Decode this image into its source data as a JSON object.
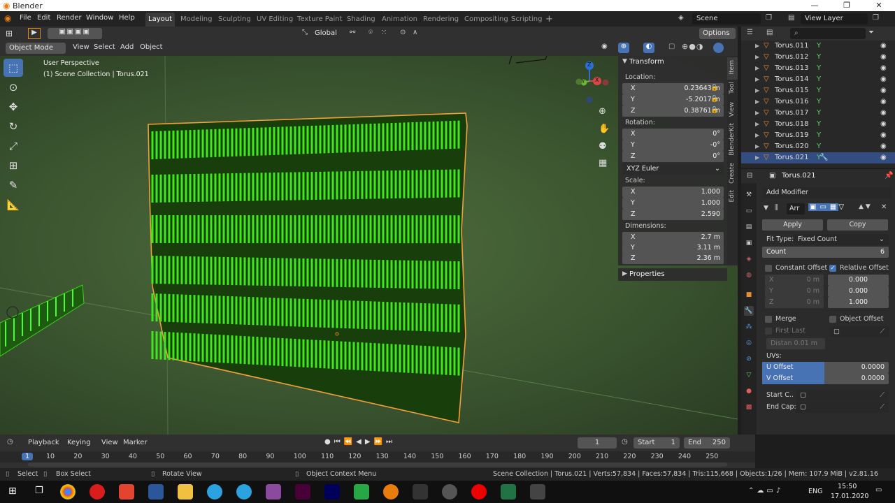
{
  "topbar": {
    "title": "Blender",
    "minimize": "—",
    "maximize": "❐",
    "close": "✕"
  },
  "menu": [
    "File",
    "Edit",
    "Render",
    "Window",
    "Help"
  ],
  "workspaces": [
    "Layout",
    "Modeling",
    "Sculpting",
    "UV Editing",
    "Texture Paint",
    "Shading",
    "Animation",
    "Rendering",
    "Compositing",
    "Scripting"
  ],
  "scene": {
    "label": "Scene",
    "view_layer": "View Layer"
  },
  "viewport_header": {
    "transform_orientation": "Global",
    "options": "Options",
    "mode": "Object Mode",
    "menus": [
      "View",
      "Select",
      "Add",
      "Object"
    ]
  },
  "viewport": {
    "perspective": "User Perspective",
    "collection": "(1) Scene Collection | Torus.021",
    "gizmo_axes": {
      "x": "X",
      "y": "Y",
      "z": "Z"
    }
  },
  "npanel": {
    "tabs": [
      "Item",
      "Tool",
      "View",
      "BlenderKit",
      "Create",
      "Edit"
    ],
    "transform_title": "Transform",
    "location_label": "Location:",
    "location": [
      {
        "k": "X",
        "v": "0.23643 m"
      },
      {
        "k": "Y",
        "v": "-5.2017 m"
      },
      {
        "k": "Z",
        "v": "0.38761 m"
      }
    ],
    "rotation_label": "Rotation:",
    "rotation": [
      {
        "k": "X",
        "v": "0°"
      },
      {
        "k": "Y",
        "v": "-0°"
      },
      {
        "k": "Z",
        "v": "0°"
      }
    ],
    "rotation_mode": "XYZ Euler",
    "scale_label": "Scale:",
    "scale": [
      {
        "k": "X",
        "v": "1.000"
      },
      {
        "k": "Y",
        "v": "1.000"
      },
      {
        "k": "Z",
        "v": "2.590"
      }
    ],
    "dimensions_label": "Dimensions:",
    "dimensions": [
      {
        "k": "X",
        "v": "2.7 m"
      },
      {
        "k": "Y",
        "v": "3.11 m"
      },
      {
        "k": "Z",
        "v": "2.36 m"
      }
    ],
    "properties_title": "Properties"
  },
  "outliner": {
    "items": [
      "Torus.011",
      "Torus.012",
      "Torus.013",
      "Torus.014",
      "Torus.015",
      "Torus.016",
      "Torus.017",
      "Torus.018",
      "Torus.019",
      "Torus.020",
      "Torus.021"
    ],
    "selected_index": 10
  },
  "properties": {
    "object_name": "Torus.021",
    "add_modifier": "Add Modifier",
    "modifier_short": "Arr",
    "apply": "Apply",
    "copy": "Copy",
    "fit_type_label": "Fit Type:",
    "fit_type_value": "Fixed Count",
    "count_label": "Count",
    "count_value": "6",
    "constant_offset": "Constant Offset",
    "relative_offset": "Relative Offset",
    "const_xyz": [
      {
        "k": "X",
        "v": "0 m"
      },
      {
        "k": "Y",
        "v": "0 m"
      },
      {
        "k": "Z",
        "v": "0 m"
      }
    ],
    "rel_xyz": [
      "0.000",
      "0.000",
      "1.000"
    ],
    "merge": "Merge",
    "object_offset": "Object Offset",
    "first_last": "First Last",
    "distance": "Distan",
    "distance_value": "0.01 m",
    "uvs_label": "UVs:",
    "u_offset": "U Offset",
    "u_value": "0.0000",
    "v_offset": "V Offset",
    "v_value": "0.0000",
    "start_cap": "Start C..",
    "end_cap": "End Cap:"
  },
  "timeline": {
    "menus": [
      "Playback",
      "Keying",
      "View",
      "Marker"
    ],
    "current_frame": "1",
    "start_label": "Start",
    "start_value": "1",
    "end_label": "End",
    "end_value": "250",
    "ruler": [
      "1",
      "10",
      "20",
      "30",
      "40",
      "50",
      "60",
      "70",
      "80",
      "90",
      "100",
      "110",
      "120",
      "130",
      "140",
      "150",
      "160",
      "170",
      "180",
      "190",
      "200",
      "210",
      "220",
      "230",
      "240",
      "250"
    ]
  },
  "statusbar": {
    "select": "Select",
    "box_select": "Box Select",
    "rotate_view": "Rotate View",
    "context_menu": "Object Context Menu",
    "stats": "Scene Collection | Torus.021 | Verts:57,834 | Faces:57,834 | Tris:115,668 | Objects:1/26 | Mem: 107.9 MiB | v2.81.16"
  },
  "taskbar": {
    "lang": "ENG",
    "time": "15:50",
    "date": "17.01.2020"
  },
  "colors": {
    "accent": "#4772b3",
    "selected_outline": "#f2a03a",
    "mesh_green": "#3fe81c"
  }
}
